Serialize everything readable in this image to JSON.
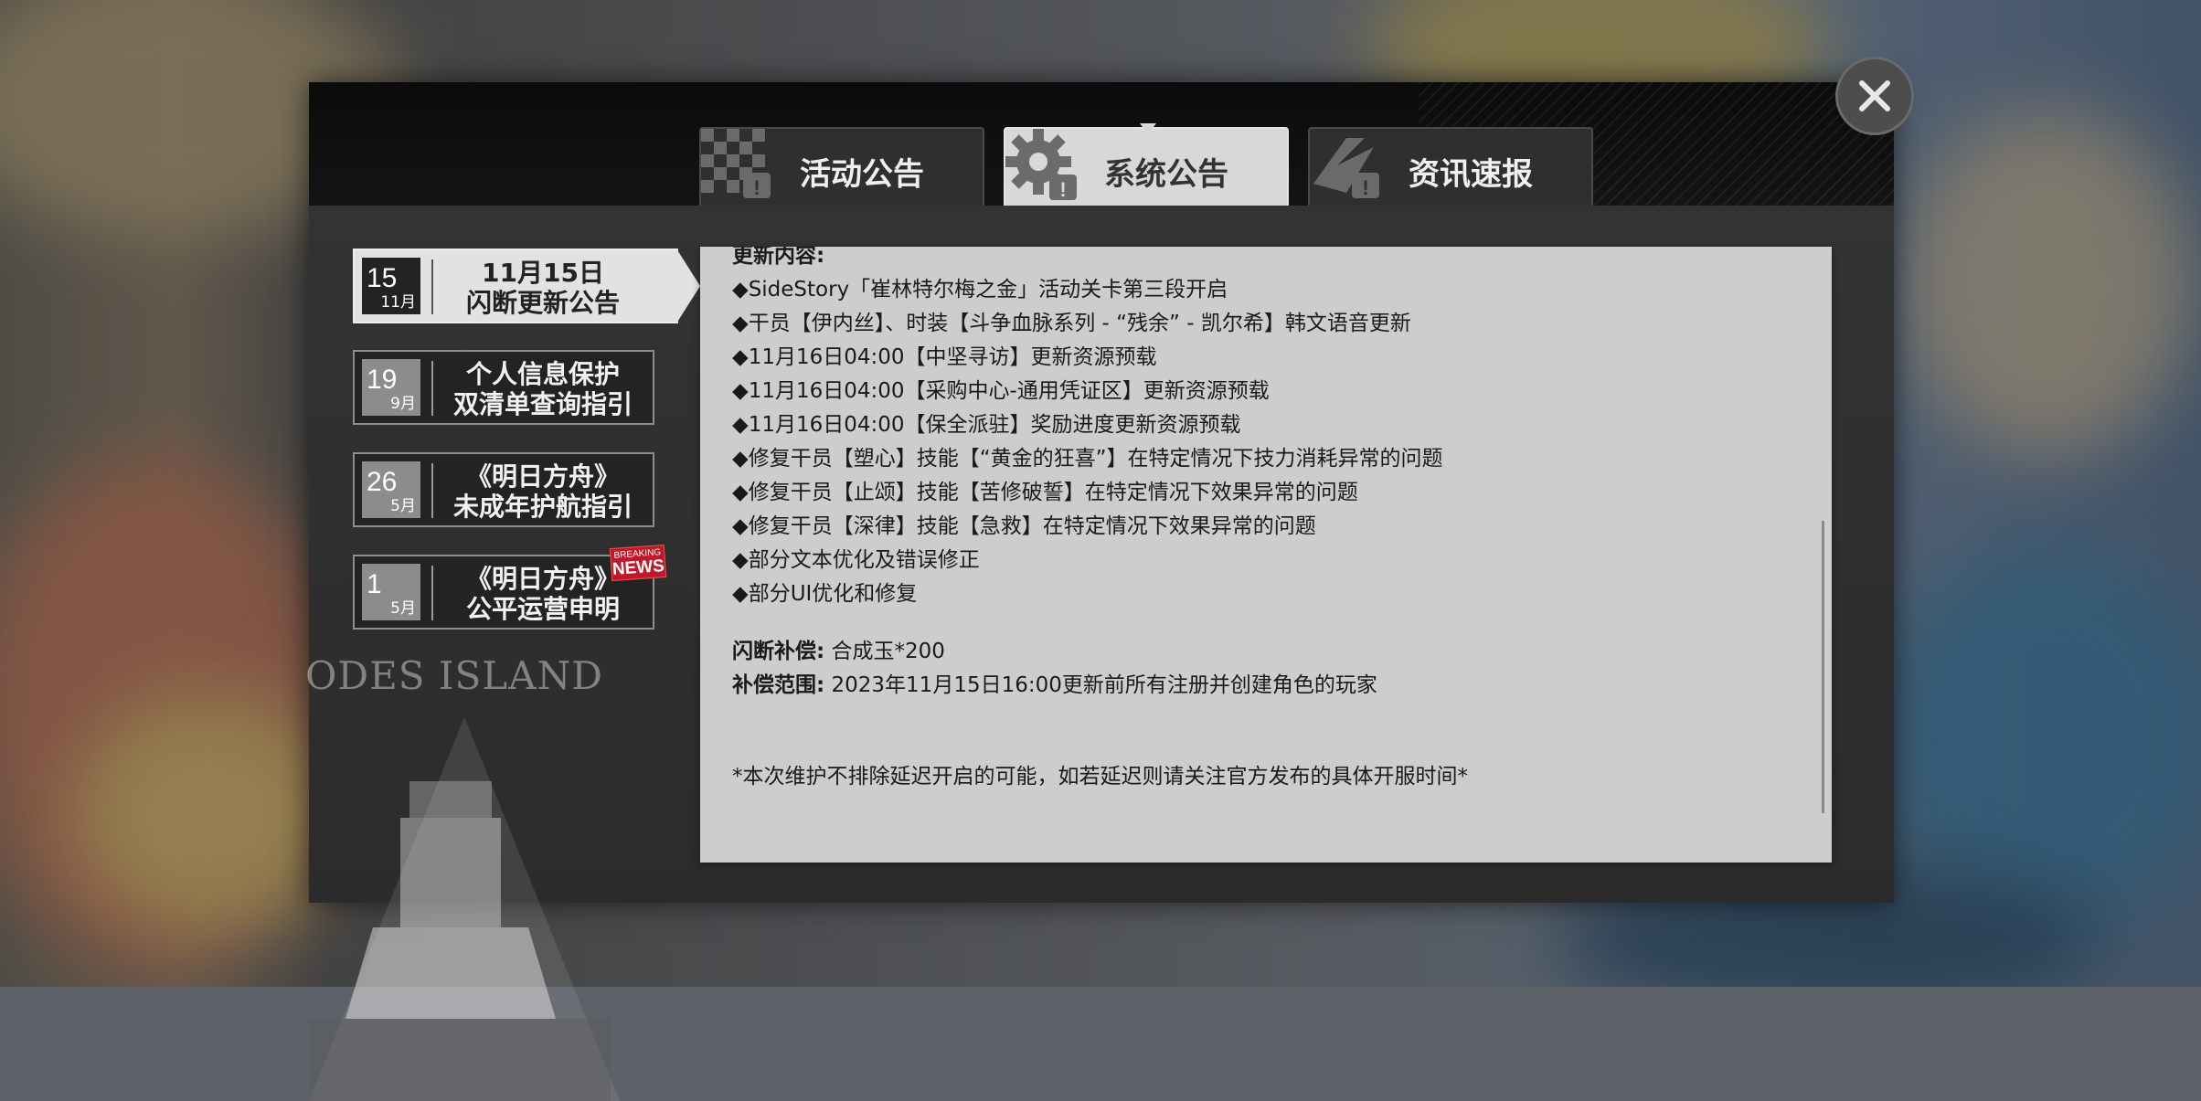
{
  "tabs": [
    {
      "label": "活动公告",
      "icon": "checkered-flag-icon"
    },
    {
      "label": "系统公告",
      "icon": "gear-icon",
      "active": true
    },
    {
      "label": "资讯速报",
      "icon": "megaphone-icon"
    }
  ],
  "sidebar": [
    {
      "day": "15",
      "month": "11月",
      "title_line1": "11月15日",
      "title_line2": "闪断更新公告",
      "active": true
    },
    {
      "day": "19",
      "month": "9月",
      "title_line1": "个人信息保护",
      "title_line2": "双清单查询指引"
    },
    {
      "day": "26",
      "month": "5月",
      "title_line1": "《明日方舟》",
      "title_line2": "未成年护航指引"
    },
    {
      "day": "1",
      "month": "5月",
      "title_line1": "《明日方舟》",
      "title_line2": "公平运营申明",
      "badge_top": "BREAKING",
      "badge_bottom": "NEWS"
    }
  ],
  "emblem_text": "ODES ISLAND",
  "content": {
    "heading": "更新内容:",
    "items": [
      "◆SideStory「崔林特尔梅之金」活动关卡第三段开启",
      "◆干员【伊内丝】、时装【斗争血脉系列 - “残余” - 凯尔希】韩文语音更新",
      "◆11月16日04:00【中坚寻访】更新资源预载",
      "◆11月16日04:00【采购中心-通用凭证区】更新资源预载",
      "◆11月16日04:00【保全派驻】奖励进度更新资源预载",
      "◆修复干员【塑心】技能【“黄金的狂喜”】在特定情况下技力消耗异常的问题",
      "◆修复干员【止颂】技能【苦修破誓】在特定情况下效果异常的问题",
      "◆修复干员【深律】技能【急救】在特定情况下效果异常的问题",
      "◆部分文本优化及错误修正",
      "◆部分UI优化和修复"
    ],
    "compensation_label": "闪断补偿:",
    "compensation_value": "合成玉*200",
    "scope_label": "补偿范围:",
    "scope_value": "2023年11月15日16:00更新前所有注册并创建角色的玩家",
    "footnote": "*本次维护不排除延迟开启的可能，如若延迟则请关注官方发布的具体开服时间*"
  },
  "colors": {
    "active_tab": "#d8d8d8",
    "badge": "#c0182a"
  }
}
